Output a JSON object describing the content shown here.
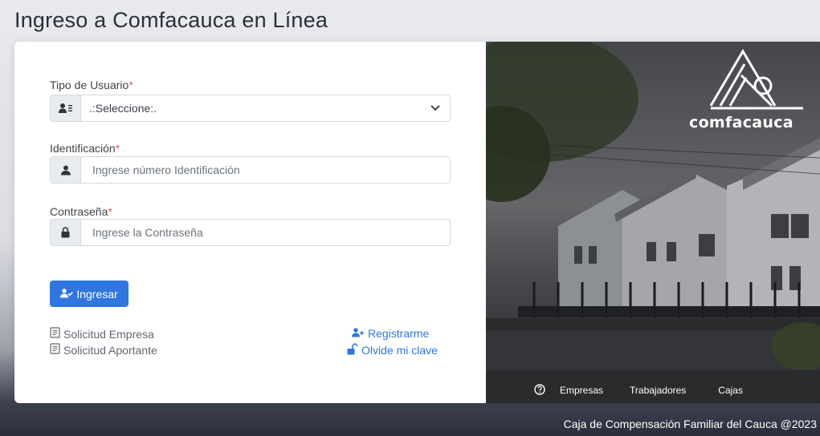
{
  "page": {
    "title": "Ingreso a Comfacauca en Línea",
    "footer": "Caja de Compensación Familiar del Cauca @2023"
  },
  "form": {
    "user_type_label": "Tipo de Usuario",
    "user_type_value": ".:Seleccione:.",
    "id_label": "Identificación",
    "id_placeholder": "Ingrese número Identificación",
    "password_label": "Contraseña",
    "password_placeholder": "Ingrese la Contraseña",
    "required_mark": "*",
    "login_button": "Ingresar"
  },
  "links": {
    "left": [
      {
        "label": "Solicitud Empresa",
        "icon": "document-icon"
      },
      {
        "label": "Solicitud Aportante",
        "icon": "document-icon"
      }
    ],
    "right": [
      {
        "label": "Registrarme",
        "icon": "user-plus-icon"
      },
      {
        "label": "Olvide mi clave",
        "icon": "unlock-icon"
      }
    ]
  },
  "side_panel": {
    "brand": "comfacauca",
    "nav": [
      "Empresas",
      "Trabajadores",
      "Cajas"
    ],
    "help_icon": "help-icon"
  },
  "colors": {
    "primary": "#2f76e0",
    "required": "#e05a5a",
    "title": "#2b2f3a"
  }
}
